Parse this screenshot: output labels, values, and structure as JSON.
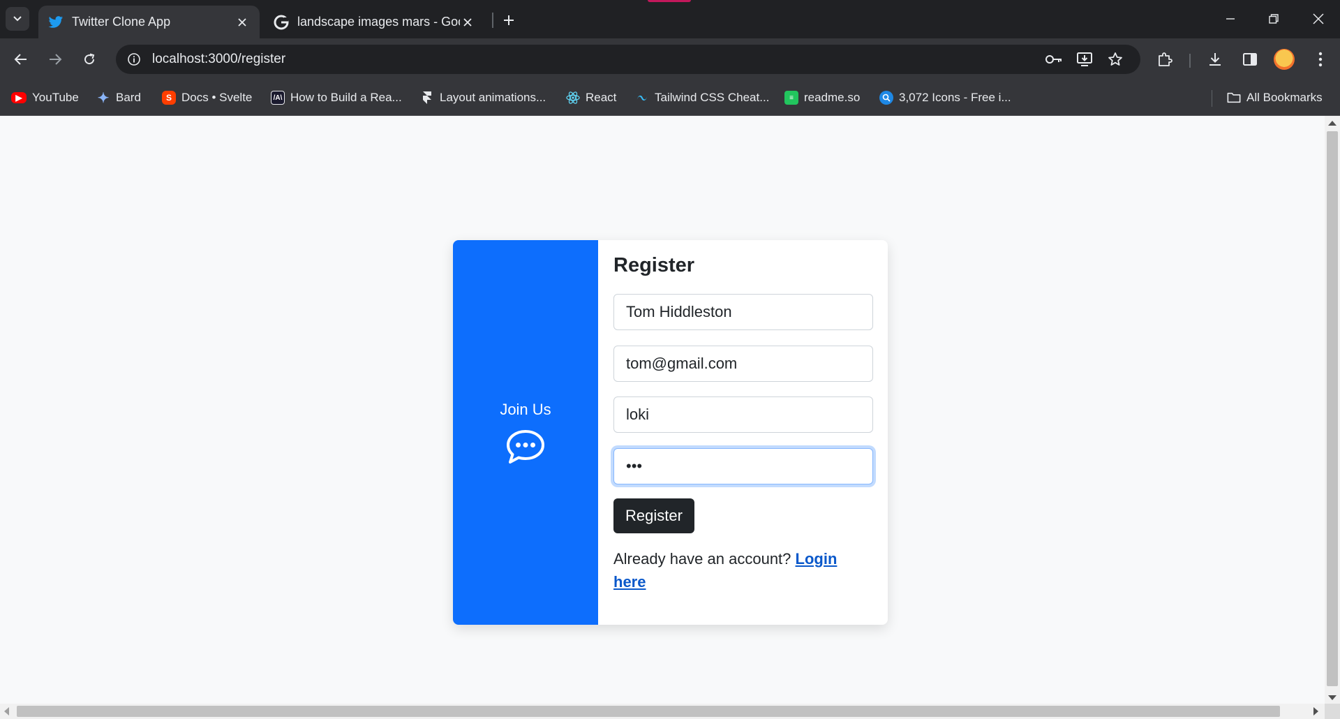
{
  "browser": {
    "tabs": [
      {
        "title": "Twitter Clone App",
        "active": true,
        "icon": "twitter-bird-icon"
      },
      {
        "title": "landscape images mars - Goog",
        "active": false,
        "icon": "google-g-icon"
      }
    ],
    "address": {
      "url": "localhost:3000/register"
    },
    "bookmarks": [
      {
        "label": "YouTube",
        "icon": "youtube-icon",
        "color": "#ff0000"
      },
      {
        "label": "Bard",
        "icon": "bard-sparkle-icon",
        "color": "#8ab4f8"
      },
      {
        "label": "Docs • Svelte",
        "icon": "svelte-icon",
        "color": "#ff3e00"
      },
      {
        "label": "How to Build a Rea...",
        "icon": "article-icon",
        "color": "#1a1a2e"
      },
      {
        "label": "Layout animations...",
        "icon": "framer-icon",
        "color": "#e8eaed"
      },
      {
        "label": "React",
        "icon": "react-icon",
        "color": "#61dafb"
      },
      {
        "label": "Tailwind CSS Cheat...",
        "icon": "tailwind-icon",
        "color": "#38bdf8"
      },
      {
        "label": "readme.so",
        "icon": "readme-icon",
        "color": "#22c55e"
      },
      {
        "label": "3,072 Icons - Free i...",
        "icon": "icons-search-icon",
        "color": "#1e88e5"
      }
    ],
    "all_bookmarks_label": "All Bookmarks"
  },
  "page": {
    "join_label": "Join Us",
    "join_icon": "chat-bubble-dots-icon",
    "register_title": "Register",
    "fields": {
      "name": "Tom Hiddleston",
      "email": "tom@gmail.com",
      "username": "loki",
      "password": "•••"
    },
    "register_button": "Register",
    "login_prompt": "Already have an account?",
    "login_link": "Login here",
    "colors": {
      "accent": "#0d6efd",
      "button": "#212529",
      "link": "#0a58ca"
    }
  }
}
